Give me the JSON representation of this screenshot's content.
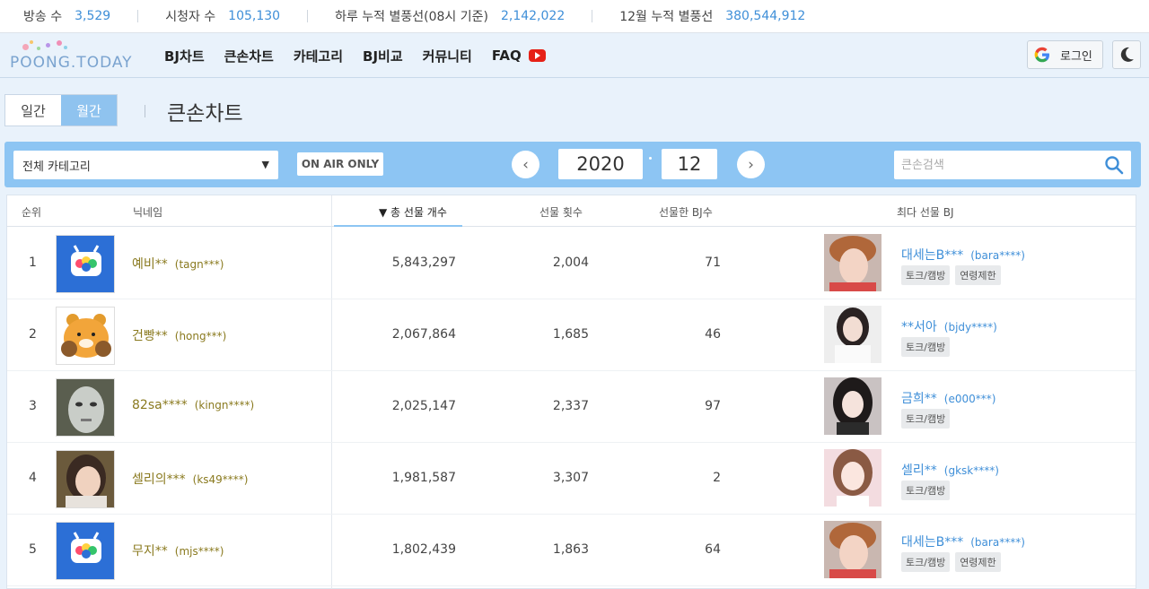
{
  "stats": [
    {
      "label": "방송 수",
      "value": "3,529"
    },
    {
      "label": "시청자 수",
      "value": "105,130"
    },
    {
      "label": "하루 누적 별풍선(08시 기준)",
      "value": "2,142,022"
    },
    {
      "label": "12월 누적 별풍선",
      "value": "380,544,912"
    }
  ],
  "nav": {
    "logo": "POONG.TODAY",
    "menu": [
      "BJ차트",
      "큰손차트",
      "카테고리",
      "BJ비교",
      "커뮤니티",
      "FAQ"
    ],
    "login_label": "로그인"
  },
  "period": {
    "daily": "일간",
    "monthly": "월간",
    "selected": "월간"
  },
  "page_title": "큰손차트",
  "filter": {
    "category": "전체 카테고리",
    "onair": "ON AIR ONLY",
    "prev": "‹",
    "next": "›",
    "year": "2020",
    "month": "12",
    "search_placeholder": "큰손검색"
  },
  "table": {
    "headers": {
      "rank": "순위",
      "nick": "닉네임",
      "total": "▼ 총 선물 개수",
      "count": "선물 횟수",
      "bjs": "선물한 BJ수",
      "top_bj": "최다 선물 BJ"
    },
    "rows": [
      {
        "rank": "1",
        "nick": "예비**",
        "uid": "(tagn***)",
        "avatar": "tv",
        "total": "5,843,297",
        "count": "2,004",
        "bjs": "71",
        "top_name": "대세는B***",
        "top_uid": "(bara****)",
        "tags": [
          "토크/캠방",
          "연령제한"
        ],
        "photo": "a"
      },
      {
        "rank": "2",
        "nick": "건빵**",
        "uid": "(hong***)",
        "avatar": "bear",
        "total": "2,067,864",
        "count": "1,685",
        "bjs": "46",
        "top_name": "**서아",
        "top_uid": "(bjdy****)",
        "tags": [
          "토크/캠방"
        ],
        "photo": "b"
      },
      {
        "rank": "3",
        "nick": "82sa****",
        "uid": "(kingn****)",
        "avatar": "mask",
        "total": "2,025,147",
        "count": "2,337",
        "bjs": "97",
        "top_name": "금희**",
        "top_uid": "(e000***)",
        "tags": [
          "토크/캠방"
        ],
        "photo": "c"
      },
      {
        "rank": "4",
        "nick": "셀리의***",
        "uid": "(ks49****)",
        "avatar": "girl",
        "total": "1,981,587",
        "count": "3,307",
        "bjs": "2",
        "top_name": "셀리**",
        "top_uid": "(gksk****)",
        "tags": [
          "토크/캠방"
        ],
        "photo": "d"
      },
      {
        "rank": "5",
        "nick": "무지**",
        "uid": "(mjs****)",
        "avatar": "tv",
        "total": "1,802,439",
        "count": "1,863",
        "bjs": "64",
        "top_name": "대세는B***",
        "top_uid": "(bara****)",
        "tags": [
          "토크/캠방",
          "연령제한"
        ],
        "photo": "a"
      }
    ]
  },
  "colors": {
    "accent": "#8dc5f3",
    "link": "#3f8fd8",
    "nick": "#8a7a1f",
    "youtube": "#e62117"
  }
}
